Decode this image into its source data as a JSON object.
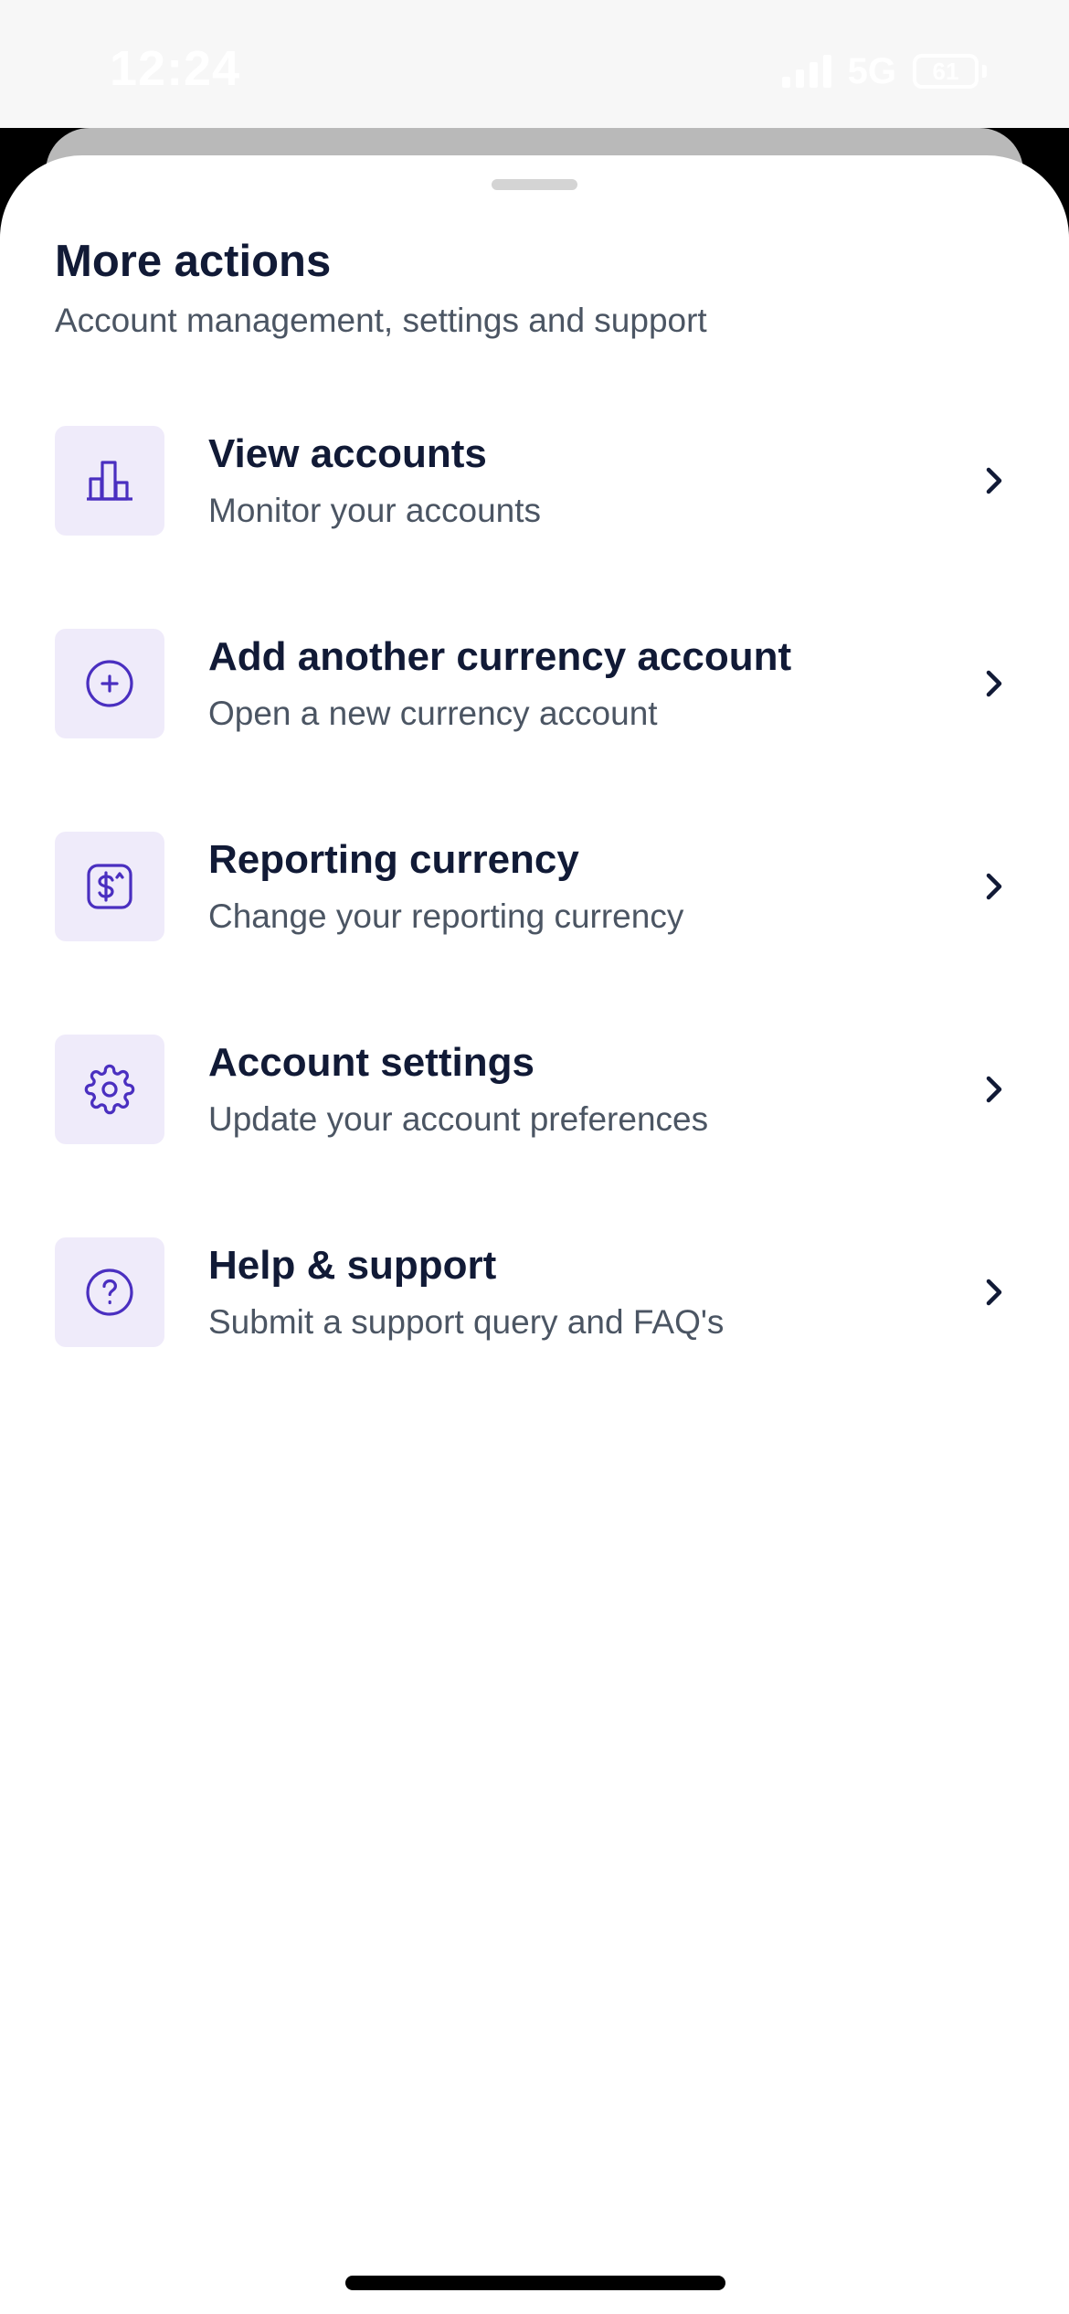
{
  "status_bar": {
    "time": "12:24",
    "network": "5G",
    "battery": "61"
  },
  "sheet": {
    "title": "More actions",
    "subtitle": "Account management, settings and support"
  },
  "actions": [
    {
      "icon": "bar-chart-icon",
      "title": "View accounts",
      "description": "Monitor your accounts"
    },
    {
      "icon": "plus-circle-icon",
      "title": "Add another currency account",
      "description": "Open a new currency account"
    },
    {
      "icon": "dollar-exchange-icon",
      "title": "Reporting currency",
      "description": "Change your reporting currency"
    },
    {
      "icon": "gear-icon",
      "title": "Account settings",
      "description": "Update your account preferences"
    },
    {
      "icon": "question-circle-icon",
      "title": "Help & support",
      "description": "Submit a support query and FAQ's"
    }
  ],
  "colors": {
    "accent": "#4a2fc0",
    "icon_background": "#efebfa",
    "title_text": "#111a36",
    "secondary_text": "#4b5563"
  }
}
